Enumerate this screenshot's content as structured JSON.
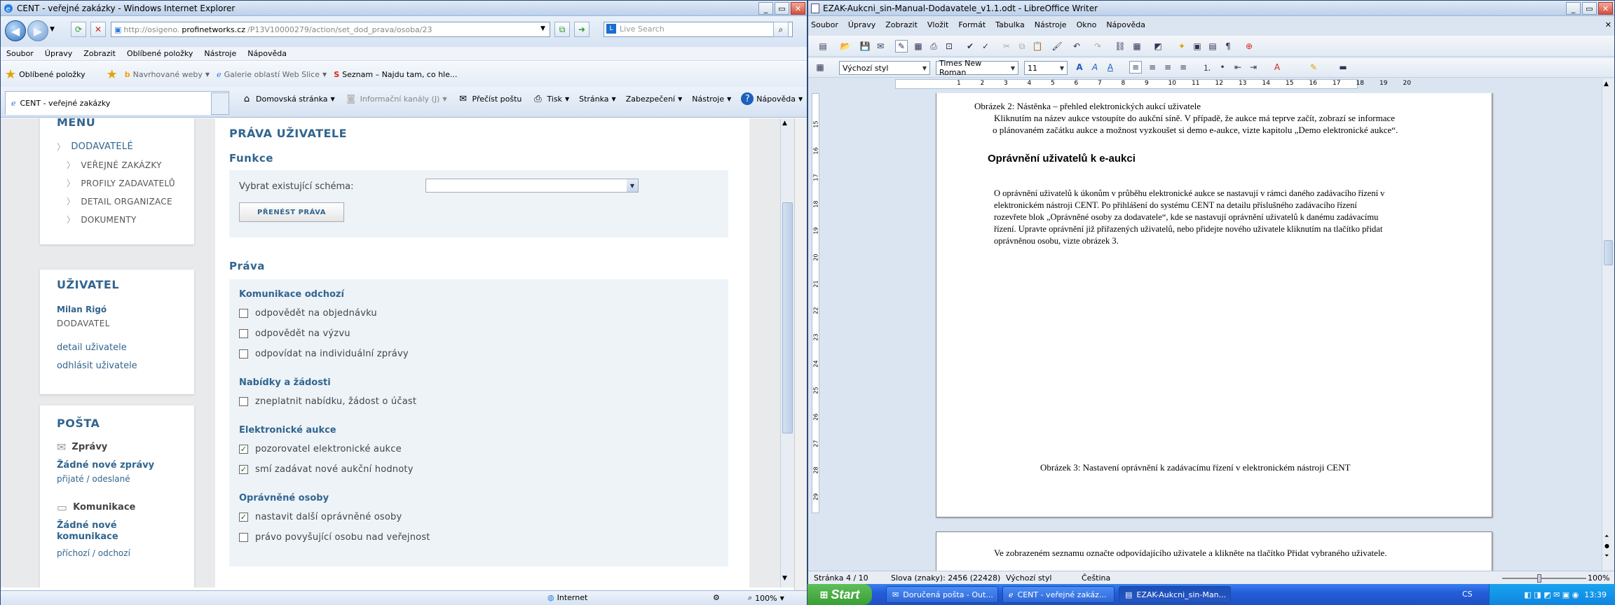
{
  "ie": {
    "title": "CENT - veřejné zakázky - Windows Internet Explorer",
    "url_prefix": "http://osigeno.",
    "url_domain": "profinetworks.cz",
    "url_path": "/P13V10000279/action/set_dod_prava/osoba/23",
    "search_placeholder": "Live Search",
    "menu": [
      "Soubor",
      "Úpravy",
      "Zobrazit",
      "Oblíbené položky",
      "Nástroje",
      "Nápověda"
    ],
    "favorites": {
      "label": "Oblíbené položky",
      "items": [
        "Navrhované weby",
        "Galerie oblastí Web Slice",
        "Seznam – Najdu tam, co hle..."
      ]
    },
    "tab_title": "CENT - veřejné zakázky",
    "commands": {
      "home": "Domovská stránka",
      "feeds": "Informační kanály (J)",
      "mail": "Přečíst poštu",
      "print": "Tisk",
      "page": "Stránka",
      "safety": "Zabezpečení",
      "tools": "Nástroje",
      "help": "Nápověda"
    },
    "status": {
      "zone": "Internet",
      "zoom": "100%"
    }
  },
  "sidebar": {
    "menu_heading": "MENU",
    "menu_items": [
      "DODAVATELÉ",
      "VEŘEJNÉ ZAKÁZKY",
      "PROFILY ZADAVATELŮ",
      "DETAIL ORGANIZACE",
      "DOKUMENTY"
    ],
    "user_heading": "UŽIVATEL",
    "user_name": "Milan Rigó",
    "user_role": "DODAVATEL",
    "user_detail": "detail uživatele",
    "user_logout": "odhlásit uživatele",
    "mail_heading": "POŠTA",
    "messages_label": "Zprávy",
    "messages_none": "Žádné nové zprávy",
    "received": "přijaté",
    "slash": "/",
    "sent": "odeslané",
    "comm_label": "Komunikace",
    "comm_none": "Žádné nové komunikace",
    "incoming": "příchozí",
    "outgoing": "odchozí"
  },
  "main": {
    "title": "PRÁVA UŽIVATELE",
    "functions_heading": "Funkce",
    "schema_label": "Vybrat existující schéma:",
    "transfer_button": "PŘENÉST PRÁVA",
    "rights_heading": "Práva",
    "groups": [
      {
        "title": "Komunikace odchozí",
        "items": [
          {
            "label": "odpovědět na objednávku",
            "checked": false
          },
          {
            "label": "odpovědět na výzvu",
            "checked": false
          },
          {
            "label": "odpovídat na individuální zprávy",
            "checked": false
          }
        ]
      },
      {
        "title": "Nabídky a žádosti",
        "items": [
          {
            "label": "zneplatnit nabídku, žádost o účast",
            "checked": false
          }
        ]
      },
      {
        "title": "Elektronické aukce",
        "items": [
          {
            "label": "pozorovatel elektronické aukce",
            "checked": true
          },
          {
            "label": "smí zadávat nové aukční hodnoty",
            "checked": true
          }
        ]
      },
      {
        "title": "Oprávněné osoby",
        "items": [
          {
            "label": "nastavit další oprávněné osoby",
            "checked": true
          },
          {
            "label": "právo povyšující osobu nad veřejnost",
            "checked": false
          }
        ]
      }
    ],
    "check_mark": "✓"
  },
  "lo": {
    "title": "EZAK-Aukcni_sin-Manual-Dodavatele_v1.1.odt - LibreOffice Writer",
    "menu": [
      "Soubor",
      "Úpravy",
      "Zobrazit",
      "Vložit",
      "Formát",
      "Tabulka",
      "Nástroje",
      "Okno",
      "Nápověda"
    ],
    "style": "Výchozí styl",
    "font": "Times New Roman",
    "size": "11",
    "ruler_numbers": [
      "1",
      "2",
      "3",
      "4",
      "5",
      "6",
      "7",
      "8",
      "9",
      "10",
      "11",
      "12",
      "13",
      "14",
      "15",
      "16",
      "17",
      "18",
      "19",
      "20"
    ],
    "vruler_numbers": [
      "15",
      "16",
      "17",
      "18",
      "19",
      "20",
      "21",
      "22",
      "23",
      "24",
      "25",
      "26",
      "27",
      "28",
      "29"
    ],
    "doc": {
      "caption2": "Obrázek 2: Nástěnka – přehled elektronických aukcí uživatele",
      "para1_line1": "Kliknutím na název aukce vstoupíte do aukční síně. V případě, že aukce má teprve začít, zobrazí se informace",
      "para1_line2": "o plánovaném začátku aukce a možnost vyzkoušet si demo e-aukce, vizte kapitolu „Demo elektronické aukce“.",
      "heading": "Oprávnění uživatelů k e-aukci",
      "para2_line1": "O oprávnění uživatelů k úkonům v průběhu elektronické aukce se nastavují v rámci daného zadávacího řízení v",
      "para2_line2": "elektronickém nástroji CENT. Po přihlášení do systému CENT na detailu příslušného zadávacího řízení",
      "para2_line3": "rozevřete blok „Oprávněné osoby za dodavatele“, kde se nastavují oprávnění uživatelů k danému zadávacímu",
      "para2_line4": "řízení. Upravte oprávnění již přiřazených uživatelů, nebo přidejte nového uživatele kliknutím na tlačítko přidat",
      "para2_line5": "oprávněnou osobu, vizte obrázek 3.",
      "caption3": "Obrázek 3: Nastavení oprávnění k zadávacímu řízení v elektronickém nástroji CENT",
      "page2_line1": "Ve zobrazeném seznamu označte odpovídajícího uživatele a klikněte na tlačítko Přidat vybraného uživatele."
    },
    "status": {
      "page": "Stránka 4 / 10",
      "words": "Slova (znaky): 2456 (22428)",
      "style": "Výchozí styl",
      "lang": "Čeština",
      "zoom": "100%"
    }
  },
  "taskbar": {
    "start": "Start",
    "tasks": [
      "Doručená pošta - Out...",
      "CENT - veřejné zakáz...",
      "EZAK-Aukcni_sin-Man..."
    ],
    "lang": "CS",
    "time": "13:39"
  },
  "colors": {
    "accent": "#31658f",
    "panel_bg": "#eef3f8",
    "page_bg": "#e9eaec"
  }
}
